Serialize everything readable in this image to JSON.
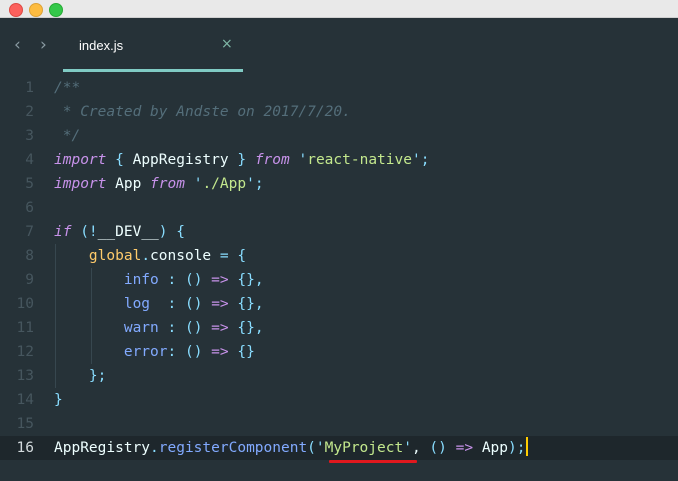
{
  "tabs": [
    {
      "label": "index.js",
      "close_glyph": "×"
    }
  ],
  "nav": {
    "back_glyph": "‹",
    "forward_glyph": "›"
  },
  "editor": {
    "line_numbers": [
      "1",
      "2",
      "3",
      "4",
      "5",
      "6",
      "7",
      "8",
      "9",
      "10",
      "11",
      "12",
      "13",
      "14",
      "15",
      "16"
    ],
    "active_line": 16,
    "lines": [
      {
        "tokens": [
          {
            "t": "/**",
            "c": "cm"
          }
        ]
      },
      {
        "tokens": [
          {
            "t": " * Created by Andste on 2017/7/20.",
            "c": "cm"
          }
        ]
      },
      {
        "tokens": [
          {
            "t": " */",
            "c": "cm"
          }
        ]
      },
      {
        "tokens": [
          {
            "t": "import",
            "c": "kw"
          },
          {
            "t": " ",
            "c": "plain"
          },
          {
            "t": "{",
            "c": "pn"
          },
          {
            "t": " AppRegistry ",
            "c": "plain"
          },
          {
            "t": "}",
            "c": "pn"
          },
          {
            "t": " ",
            "c": "plain"
          },
          {
            "t": "from",
            "c": "kw"
          },
          {
            "t": " ",
            "c": "plain"
          },
          {
            "t": "'",
            "c": "pn"
          },
          {
            "t": "react-native",
            "c": "str"
          },
          {
            "t": "'",
            "c": "pn"
          },
          {
            "t": ";",
            "c": "pn"
          }
        ]
      },
      {
        "tokens": [
          {
            "t": "import",
            "c": "kw"
          },
          {
            "t": " App ",
            "c": "plain"
          },
          {
            "t": "from",
            "c": "kw"
          },
          {
            "t": " ",
            "c": "plain"
          },
          {
            "t": "'",
            "c": "pn"
          },
          {
            "t": "./App",
            "c": "str"
          },
          {
            "t": "'",
            "c": "pn"
          },
          {
            "t": ";",
            "c": "pn"
          }
        ]
      },
      {
        "tokens": []
      },
      {
        "tokens": [
          {
            "t": "if",
            "c": "kw"
          },
          {
            "t": " ",
            "c": "plain"
          },
          {
            "t": "(!",
            "c": "pn"
          },
          {
            "t": "__DEV__",
            "c": "plain"
          },
          {
            "t": ")",
            "c": "pn"
          },
          {
            "t": " ",
            "c": "plain"
          },
          {
            "t": "{",
            "c": "pn"
          }
        ]
      },
      {
        "tokens": [
          {
            "t": "    ",
            "c": "plain"
          },
          {
            "t": "global",
            "c": "glb"
          },
          {
            "t": ".",
            "c": "pn"
          },
          {
            "t": "console",
            "c": "plain"
          },
          {
            "t": " ",
            "c": "plain"
          },
          {
            "t": "=",
            "c": "op"
          },
          {
            "t": " ",
            "c": "plain"
          },
          {
            "t": "{",
            "c": "pn"
          }
        ]
      },
      {
        "tokens": [
          {
            "t": "        ",
            "c": "plain"
          },
          {
            "t": "info",
            "c": "prop"
          },
          {
            "t": " ",
            "c": "plain"
          },
          {
            "t": ":",
            "c": "pn"
          },
          {
            "t": " ",
            "c": "plain"
          },
          {
            "t": "()",
            "c": "pn"
          },
          {
            "t": " ",
            "c": "plain"
          },
          {
            "t": "=>",
            "c": "kw"
          },
          {
            "t": " ",
            "c": "plain"
          },
          {
            "t": "{},",
            "c": "pn"
          }
        ]
      },
      {
        "tokens": [
          {
            "t": "        ",
            "c": "plain"
          },
          {
            "t": "log",
            "c": "prop"
          },
          {
            "t": "  ",
            "c": "plain"
          },
          {
            "t": ":",
            "c": "pn"
          },
          {
            "t": " ",
            "c": "plain"
          },
          {
            "t": "()",
            "c": "pn"
          },
          {
            "t": " ",
            "c": "plain"
          },
          {
            "t": "=>",
            "c": "kw"
          },
          {
            "t": " ",
            "c": "plain"
          },
          {
            "t": "{},",
            "c": "pn"
          }
        ]
      },
      {
        "tokens": [
          {
            "t": "        ",
            "c": "plain"
          },
          {
            "t": "warn",
            "c": "prop"
          },
          {
            "t": " ",
            "c": "plain"
          },
          {
            "t": ":",
            "c": "pn"
          },
          {
            "t": " ",
            "c": "plain"
          },
          {
            "t": "()",
            "c": "pn"
          },
          {
            "t": " ",
            "c": "plain"
          },
          {
            "t": "=>",
            "c": "kw"
          },
          {
            "t": " ",
            "c": "plain"
          },
          {
            "t": "{},",
            "c": "pn"
          }
        ]
      },
      {
        "tokens": [
          {
            "t": "        ",
            "c": "plain"
          },
          {
            "t": "error",
            "c": "prop"
          },
          {
            "t": ":",
            "c": "pn"
          },
          {
            "t": " ",
            "c": "plain"
          },
          {
            "t": "()",
            "c": "pn"
          },
          {
            "t": " ",
            "c": "plain"
          },
          {
            "t": "=>",
            "c": "kw"
          },
          {
            "t": " ",
            "c": "plain"
          },
          {
            "t": "{}",
            "c": "pn"
          }
        ]
      },
      {
        "tokens": [
          {
            "t": "    ",
            "c": "plain"
          },
          {
            "t": "};",
            "c": "pn"
          }
        ]
      },
      {
        "tokens": [
          {
            "t": "}",
            "c": "pn"
          }
        ]
      },
      {
        "tokens": []
      },
      {
        "tokens": [
          {
            "t": "AppRegistry",
            "c": "plain"
          },
          {
            "t": ".",
            "c": "pn"
          },
          {
            "t": "registerComponent",
            "c": "fn"
          },
          {
            "t": "(",
            "c": "pn"
          },
          {
            "t": "'",
            "c": "pn"
          },
          {
            "t": "MyProject",
            "c": "str"
          },
          {
            "t": "'",
            "c": "pn"
          },
          {
            "t": ", ",
            "c": "plain"
          },
          {
            "t": "()",
            "c": "pn"
          },
          {
            "t": " ",
            "c": "plain"
          },
          {
            "t": "=>",
            "c": "kw"
          },
          {
            "t": " App",
            "c": "plain"
          },
          {
            "t": ");",
            "c": "pn"
          }
        ]
      }
    ]
  },
  "colors": {
    "background": "#263238",
    "accent": "#80cbc4",
    "highlight_underline": "#e0181e"
  }
}
